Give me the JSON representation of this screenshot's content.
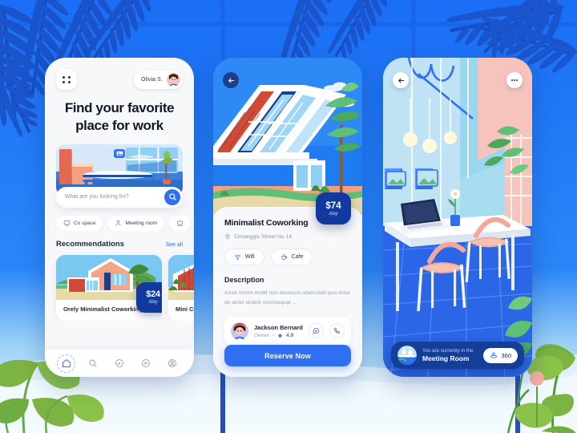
{
  "theme": {
    "brand_blue": "#2f6ff0",
    "bg_blue": "#1a6ef5",
    "deep_blue": "#123a9e",
    "card_white": "#ffffff",
    "muted_text": "#9aa1b1"
  },
  "phone1": {
    "header": {
      "menu_icon": "grid-menu-icon",
      "user_name": "Olivia S.",
      "avatar_icon": "user-avatar"
    },
    "title": "Find your favorite place for work",
    "hero": {
      "image_icon": "image-placeholder-icon"
    },
    "search": {
      "placeholder": "What are you looking for?",
      "button_icon": "search-icon"
    },
    "chips": [
      {
        "label": "Co space",
        "icon": "monitor-icon"
      },
      {
        "label": "Meeting room",
        "icon": "presentation-icon"
      },
      {
        "label": "",
        "icon": "desk-icon"
      }
    ],
    "recommendations": {
      "title": "Recommendations",
      "see_all": "See all",
      "cards": [
        {
          "name": "Orely Minimalist Coworking",
          "price": "$24",
          "unit": "/day"
        },
        {
          "name": "Mini Cow",
          "price": "",
          "unit": ""
        }
      ]
    },
    "tabs": [
      {
        "icon": "home-icon",
        "active": true
      },
      {
        "icon": "search-icon",
        "active": false
      },
      {
        "icon": "compass-icon",
        "active": false
      },
      {
        "icon": "chat-icon",
        "active": false
      },
      {
        "icon": "profile-icon",
        "active": false
      }
    ]
  },
  "phone2": {
    "back_icon": "arrow-left-icon",
    "title": "Minimalist Coworking",
    "address": "Cimanggis Street No 14",
    "address_icon": "location-pin-icon",
    "price": "$74",
    "price_unit": "/day",
    "amenities": [
      {
        "label": "Wifi",
        "icon": "wifi-icon"
      },
      {
        "label": "Cafe",
        "icon": "coffee-cup-icon"
      }
    ],
    "description_title": "Description",
    "description": "Amet minim mollit non deserunt ullamsitali qua dolor do amet sintelit oconsequat ...",
    "owner": {
      "name": "Jackson Bernard",
      "role": "Owner",
      "rating": "4.9",
      "star_icon": "star-icon",
      "avatar_icon": "owner-avatar",
      "actions": [
        {
          "icon": "chat-icon"
        },
        {
          "icon": "phone-icon"
        }
      ]
    },
    "cta": "Reserve Now"
  },
  "phone3": {
    "back_icon": "arrow-left-icon",
    "more_icon": "more-dots-icon",
    "status_small": "You are currently in the",
    "status_big": "Meeting Room",
    "badge_label": "360",
    "badge_icon": "panorama-icon",
    "thumb_icon": "room-thumbnail"
  }
}
